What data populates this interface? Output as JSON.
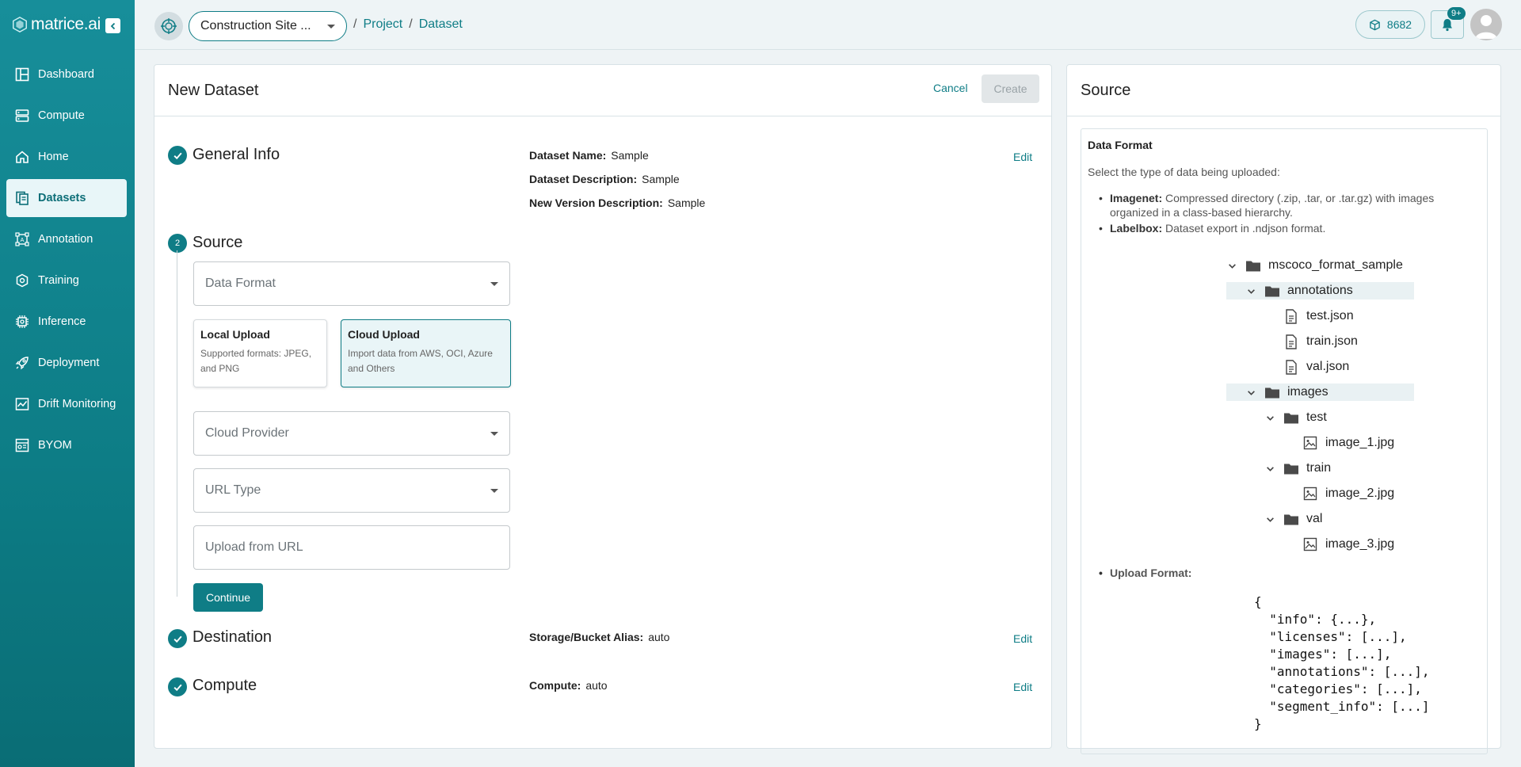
{
  "brand": {
    "name": "matrice.ai"
  },
  "sidebar": {
    "items": [
      {
        "label": "Dashboard",
        "icon": "dashboard-icon"
      },
      {
        "label": "Compute",
        "icon": "server-icon"
      },
      {
        "label": "Home",
        "icon": "home-icon"
      },
      {
        "label": "Datasets",
        "icon": "datasets-icon",
        "active": true
      },
      {
        "label": "Annotation",
        "icon": "annotation-icon"
      },
      {
        "label": "Training",
        "icon": "training-icon"
      },
      {
        "label": "Inference",
        "icon": "chip-icon"
      },
      {
        "label": "Deployment",
        "icon": "rocket-icon"
      },
      {
        "label": "Drift Monitoring",
        "icon": "chart-icon"
      },
      {
        "label": "BYOM",
        "icon": "byom-icon"
      }
    ]
  },
  "topbar": {
    "project": "Construction Site ...",
    "breadcrumb": [
      "Project",
      "Dataset"
    ],
    "credits": "8682",
    "notifications": "9+"
  },
  "main": {
    "title": "New Dataset",
    "cancel_label": "Cancel",
    "create_label": "Create",
    "edit_label": "Edit",
    "general": {
      "title": "General Info",
      "name_label": "Dataset Name:",
      "name_value": "Sample",
      "desc_label": "Dataset Description:",
      "desc_value": "Sample",
      "version_label": "New Version Description:",
      "version_value": "Sample"
    },
    "source": {
      "step": "2",
      "title": "Source",
      "data_format_placeholder": "Data Format",
      "local_title": "Local Upload",
      "local_desc": "Supported formats: JPEG, and PNG",
      "cloud_title": "Cloud Upload",
      "cloud_desc": "Import data from AWS, OCI, Azure and Others",
      "cloud_provider_placeholder": "Cloud Provider",
      "url_type_placeholder": "URL Type",
      "url_placeholder": "Upload from URL",
      "continue_label": "Continue"
    },
    "destination": {
      "title": "Destination",
      "label": "Storage/Bucket Alias:",
      "value": "auto"
    },
    "compute": {
      "title": "Compute",
      "label": "Compute:",
      "value": "auto"
    }
  },
  "side": {
    "title": "Source",
    "df_title": "Data Format",
    "df_desc": "Select the type of data being uploaded:",
    "imagenet_label": "Imagenet:",
    "imagenet_desc": "Compressed directory (.zip, .tar, or .tar.gz) with images organized in a class-based hierarchy.",
    "labelbox_label": "Labelbox:",
    "labelbox_desc": "Dataset export in .ndjson format.",
    "tree": {
      "root": "mscoco_format_sample",
      "annotations": "annotations",
      "test_json": "test.json",
      "train_json": "train.json",
      "val_json": "val.json",
      "images": "images",
      "test": "test",
      "image_1": "image_1.jpg",
      "train": "train",
      "image_2": "image_2.jpg",
      "val": "val",
      "image_3": "image_3.jpg"
    },
    "upload_format_label": "Upload Format:",
    "code": "{\n  \"info\": {...},\n  \"licenses\": [...],\n  \"images\": [...],\n  \"annotations\": [...],\n  \"categories\": [...],\n  \"segment_info\": [...]\n}"
  }
}
